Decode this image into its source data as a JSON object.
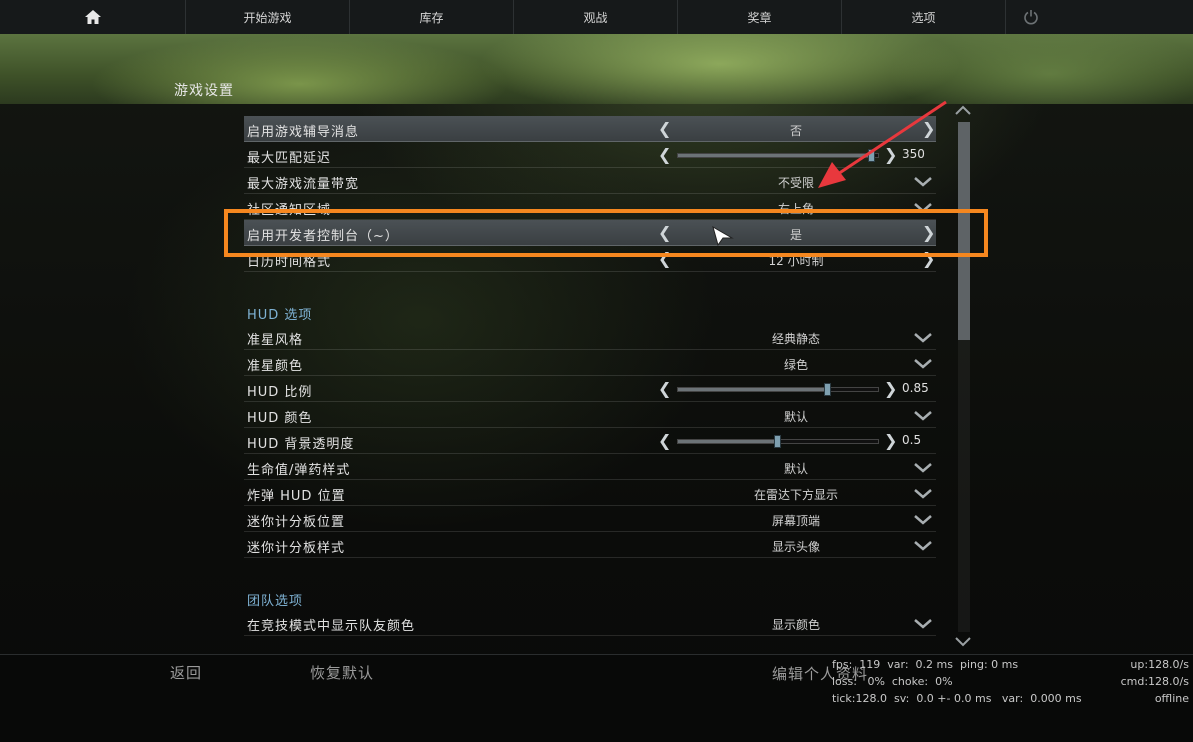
{
  "nav": {
    "items": [
      "开始游戏",
      "库存",
      "观战",
      "奖章",
      "选项"
    ]
  },
  "page": {
    "title": "游戏设置"
  },
  "settings": {
    "game_rows": [
      {
        "label": "启用游戏辅导消息",
        "value": "否",
        "type": "cycle",
        "highlight": true
      },
      {
        "label": "最大匹配延迟",
        "value": "350",
        "type": "slider",
        "level": 0.97
      },
      {
        "label": "最大游戏流量带宽",
        "value": "不受限",
        "type": "dropdown"
      },
      {
        "label": "社区通知区域",
        "value": "右上角",
        "type": "dropdown"
      },
      {
        "label": "启用开发者控制台（~）",
        "value": "是",
        "type": "cycle",
        "highlight": true
      },
      {
        "label": "日历时间格式",
        "value": "12 小时制",
        "type": "cycle"
      }
    ],
    "hud_title": "HUD 选项",
    "hud_rows": [
      {
        "label": "准星风格",
        "value": "经典静态",
        "type": "dropdown"
      },
      {
        "label": "准星颜色",
        "value": "绿色",
        "type": "dropdown"
      },
      {
        "label": "HUD 比例",
        "value": "0.85",
        "type": "slider",
        "level": 0.75
      },
      {
        "label": "HUD 颜色",
        "value": "默认",
        "type": "dropdown"
      },
      {
        "label": "HUD 背景透明度",
        "value": "0.5",
        "type": "slider",
        "level": 0.5
      },
      {
        "label": "生命值/弹药样式",
        "value": "默认",
        "type": "dropdown"
      },
      {
        "label": "炸弹 HUD 位置",
        "value": "在雷达下方显示",
        "type": "dropdown"
      },
      {
        "label": "迷你计分板位置",
        "value": "屏幕顶端",
        "type": "dropdown"
      },
      {
        "label": "迷你计分板样式",
        "value": "显示头像",
        "type": "dropdown"
      }
    ],
    "team_title": "团队选项",
    "team_rows": [
      {
        "label": "在竞技模式中显示队友颜色",
        "value": "显示颜色",
        "type": "dropdown"
      }
    ]
  },
  "bottom": {
    "back": "返回",
    "reset": "恢复默认",
    "edit_profile": "编辑个人资料"
  },
  "netgraph": {
    "line1": "fps:  119  var:  0.2 ms  ping: 0 ms",
    "line2": "loss:   0%  choke:  0%",
    "line3": "tick:128.0  sv:  0.0 +- 0.0 ms   var:  0.000 ms",
    "right1": "up:128.0/s",
    "right2": "cmd:128.0/s",
    "right3": "offline"
  },
  "colors": {
    "accent_annotation": "#f5871f",
    "annotation_arrow": "#e8383d",
    "section_heading": "#7fb3d5"
  }
}
